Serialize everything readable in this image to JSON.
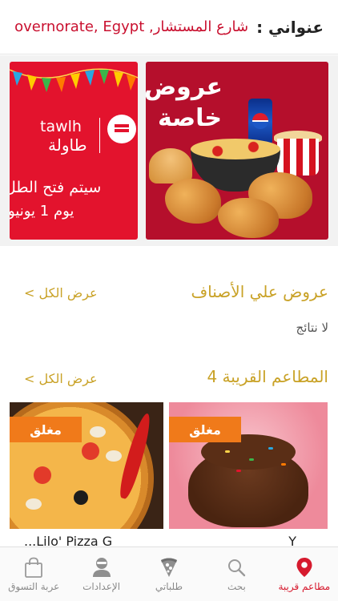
{
  "header": {
    "address_label": "عنواني :",
    "address_value": "شارع المستشار, overnorate, Egypt..."
  },
  "banners": {
    "special_offer": {
      "title_line1": "عروض",
      "title_line2": "خاصة"
    },
    "tawlh": {
      "brand_en": "tawlh",
      "brand_ar": "طاولة",
      "line1": "سيتم فتح الطل",
      "line2": "يوم 1 يونيو"
    }
  },
  "sections": {
    "category_offers": {
      "title": "عروض علي الأصناف",
      "see_all": "عرض الكل >",
      "empty_text": "لا نتائج"
    },
    "nearby": {
      "title": "المطاعم القريبة 4",
      "see_all": "عرض الكل >"
    }
  },
  "restaurants": [
    {
      "status": "مغلق",
      "name_partial": "Y"
    },
    {
      "status": "مغلق",
      "name_partial": "...Lilo' Pizza G"
    }
  ],
  "bottom_nav": [
    {
      "label": "مطاعم قريبة",
      "icon": "location-pin-icon",
      "active": true
    },
    {
      "label": "بحث",
      "icon": "search-icon",
      "active": false
    },
    {
      "label": "طلباتي",
      "icon": "pizza-slice-icon",
      "active": false
    },
    {
      "label": "الإعدادات",
      "icon": "user-icon",
      "active": false
    },
    {
      "label": "عربة التسوق",
      "icon": "shopping-bag-icon",
      "active": false
    }
  ],
  "colors": {
    "brand_red": "#d61a2e",
    "gold": "#c9a227",
    "closed_orange": "#f07a1a"
  }
}
